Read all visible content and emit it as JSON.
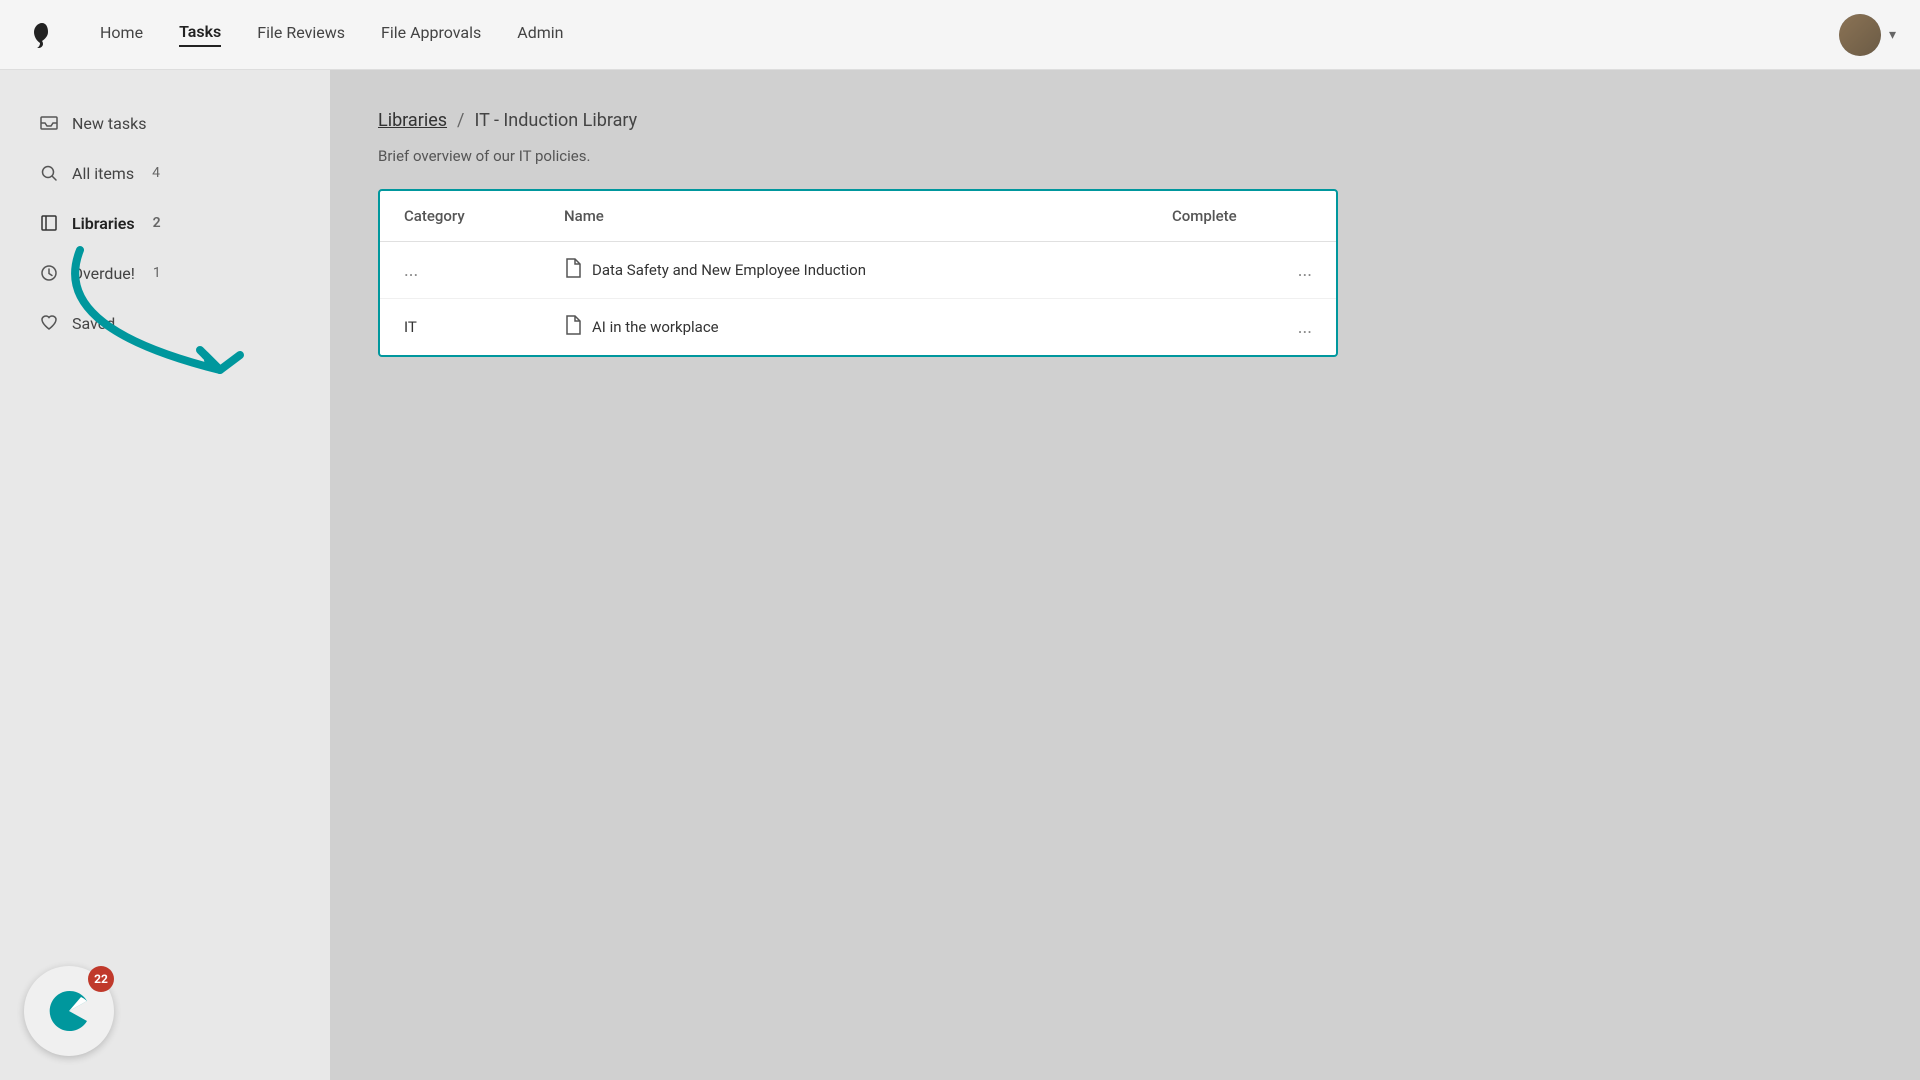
{
  "nav": {
    "links": [
      {
        "label": "Home",
        "active": false
      },
      {
        "label": "Tasks",
        "active": true
      },
      {
        "label": "File Reviews",
        "active": false
      },
      {
        "label": "File Approvals",
        "active": false
      },
      {
        "label": "Admin",
        "active": false
      }
    ]
  },
  "sidebar": {
    "items": [
      {
        "id": "new-tasks",
        "label": "New tasks",
        "icon": "inbox",
        "badge": ""
      },
      {
        "id": "all-items",
        "label": "All items",
        "icon": "search",
        "badge": "4"
      },
      {
        "id": "libraries",
        "label": "Libraries",
        "icon": "book",
        "badge": "2",
        "active": true
      },
      {
        "id": "overdue",
        "label": "Overdue!",
        "icon": "clock",
        "badge": "1"
      },
      {
        "id": "saved",
        "label": "Saved",
        "icon": "heart",
        "badge": ""
      }
    ]
  },
  "content": {
    "breadcrumb_link": "Libraries",
    "breadcrumb_sep": "/",
    "breadcrumb_current": "IT - Induction Library",
    "description": "Brief overview of our IT policies.",
    "table": {
      "columns": [
        "Category",
        "Name",
        "Complete"
      ],
      "rows": [
        {
          "category": "...",
          "name": "Data Safety and New Employee Induction",
          "complete": "..."
        },
        {
          "category": "IT",
          "name": "AI in the workplace",
          "complete": "..."
        }
      ]
    }
  },
  "widget": {
    "notification_count": "22"
  }
}
